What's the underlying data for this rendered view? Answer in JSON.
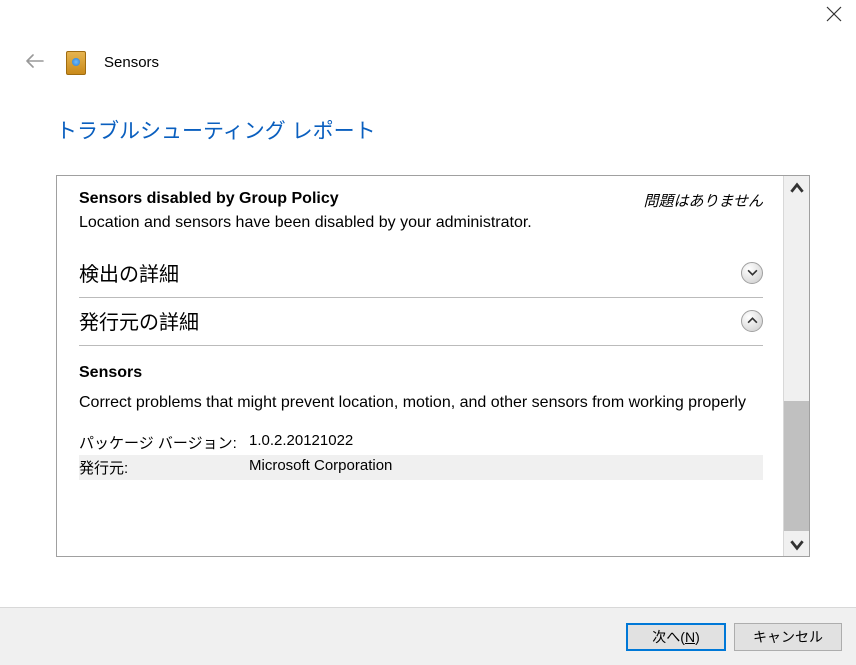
{
  "window": {
    "title": "Sensors"
  },
  "report": {
    "header": "トラブルシューティング レポート",
    "issue": {
      "title": "Sensors disabled by Group Policy",
      "status": "問題はありません",
      "description": "Location and sensors have been disabled by your administrator."
    },
    "sections": {
      "detection": {
        "title": "検出の詳細"
      },
      "publisher": {
        "title": "発行元の詳細"
      }
    },
    "publisher": {
      "package_name": "Sensors",
      "package_description": "Correct problems that might prevent location, motion, and other sensors from working properly",
      "rows": [
        {
          "label": "パッケージ バージョン:",
          "value": "1.0.2.20121022"
        },
        {
          "label": "発行元:",
          "value": "Microsoft Corporation"
        }
      ]
    }
  },
  "buttons": {
    "next_prefix": "次へ(",
    "next_hotkey": "N",
    "next_suffix": ")",
    "cancel": "キャンセル"
  }
}
